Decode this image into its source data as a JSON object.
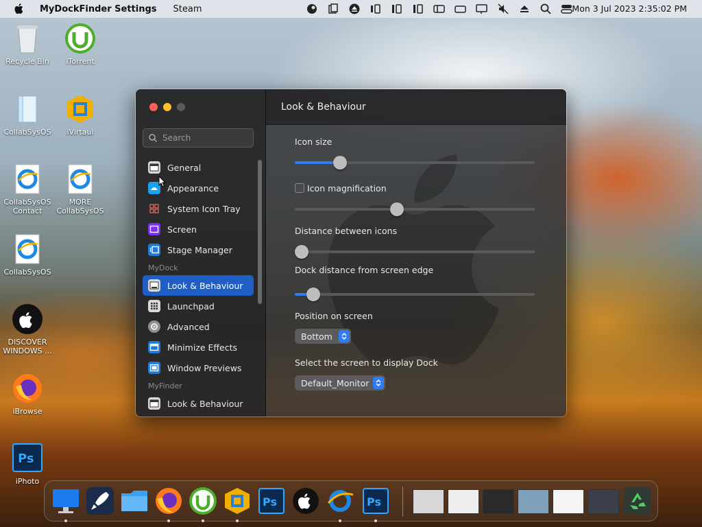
{
  "menubar": {
    "app_name": "MyDockFinder Settings",
    "menu_items": [
      "Steam"
    ],
    "clock": "Mon 3 Jul 2023 2:35:02 PM"
  },
  "desktop_icons": [
    {
      "label": "Recycle Bin",
      "icon": "recycle-bin-icon"
    },
    {
      "label": "iTorrent",
      "icon": "utorrent-icon"
    },
    {
      "label": "CollabSysOS",
      "icon": "folder-document-icon"
    },
    {
      "label": "iVirtaul",
      "icon": "virtual-box-icon"
    },
    {
      "label": "CollabSysOS Contact",
      "icon": "ie-icon"
    },
    {
      "label": "MORE CollabSysOS",
      "icon": "ie-icon"
    },
    {
      "label": "CollabSysOS",
      "icon": "ie-icon"
    },
    {
      "label": "DISCOVER WINDOWS ...",
      "icon": "apple-icon"
    },
    {
      "label": "iBrowse",
      "icon": "firefox-icon"
    },
    {
      "label": "iPhoto",
      "icon": "photoshop-icon"
    }
  ],
  "window": {
    "search_placeholder": "Search",
    "nav": {
      "general": "General",
      "appearance": "Appearance",
      "system_icon_tray": "System Icon Tray",
      "screen": "Screen",
      "stage_manager": "Stage Manager",
      "section_mydock": "MyDock",
      "look_behaviour": "Look & Behaviour",
      "launchpad": "Launchpad",
      "advanced": "Advanced",
      "minimize_effects": "Minimize Effects",
      "window_previews": "Window Previews",
      "section_myfinder": "MyFinder",
      "finder_look_behaviour": "Look & Behaviour"
    },
    "content": {
      "title": "Look & Behaviour",
      "icon_size_label": "Icon size",
      "icon_size_value": 0.17,
      "icon_magnification_label": "Icon magnification",
      "icon_magnification_checked": false,
      "icon_magnification_value": 0.42,
      "distance_icons_label": "Distance between icons",
      "distance_icons_value": 0.0,
      "dock_distance_label": "Dock distance from screen edge",
      "dock_distance_value": 0.05,
      "position_label": "Position on screen",
      "position_value": "Bottom",
      "screen_label": "Select the screen to display Dock",
      "screen_value": "Default_Monitor"
    }
  },
  "colors": {
    "accent": "#2f7cf6",
    "selection": "#1f5fc5",
    "close": "#ff5f57",
    "minimize": "#febc2e",
    "zoom_disabled": "#5a5a5c"
  },
  "dock_apps": [
    "finder-icon",
    "launchpad-rocket-icon",
    "folder-icon",
    "firefox-icon",
    "utorrent-icon",
    "virtual-box-icon",
    "photoshop-icon",
    "apple-icon",
    "ie-icon",
    "photoshop-icon",
    "window-thumbnail-1",
    "window-thumbnail-2",
    "window-thumbnail-3",
    "window-thumbnail-4",
    "window-thumbnail-5",
    "window-thumbnail-6",
    "recycle-bin-icon"
  ]
}
